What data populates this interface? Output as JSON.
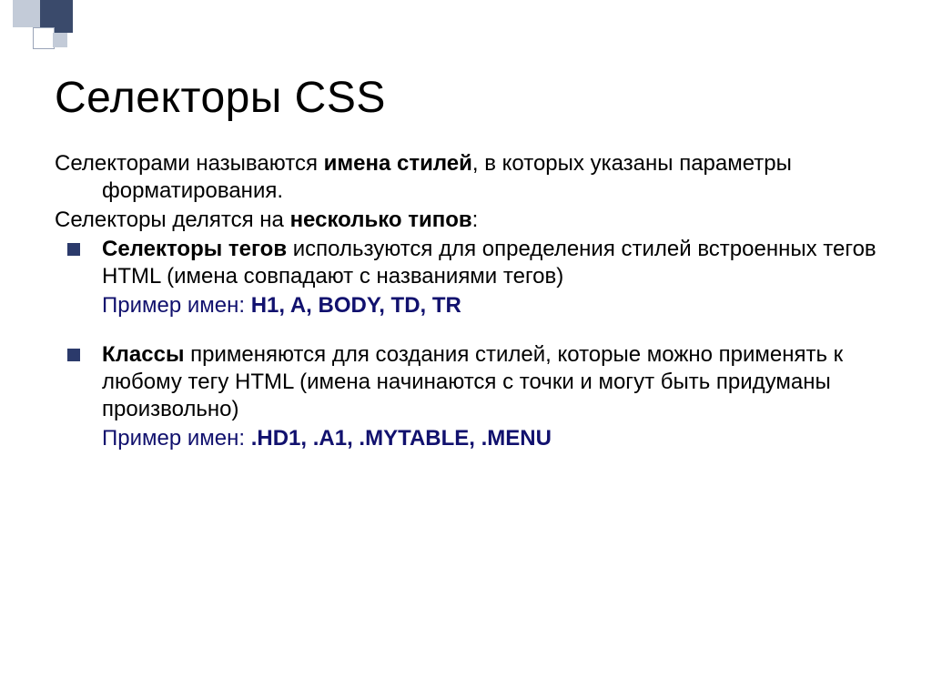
{
  "title": "Селекторы CSS",
  "intro": {
    "line1_pre": "Селекторами называются ",
    "line1_bold": "имена стилей",
    "line1_post": ", в которых указаны параметры форматирования."
  },
  "line2_pre": "Селекторы делятся на ",
  "line2_bold": "несколько типов",
  "line2_post": ":",
  "bullet1": {
    "bold": "Селекторы тегов",
    "rest": " используются для определения стилей встроенных тегов HTML (имена совпадают с названиями тегов)",
    "example_label": "Пример имен: ",
    "example_values": "H1, A, BODY, TD, TR"
  },
  "bullet2": {
    "bold": "Классы",
    "rest": " применяются для создания стилей, которые можно применять к любому тегу HTML (имена начинаются с точки и могут быть придуманы произвольно)",
    "example_label": "Пример имен: ",
    "example_values": ".HD1, .A1, .MYTABLE, .MENU"
  }
}
